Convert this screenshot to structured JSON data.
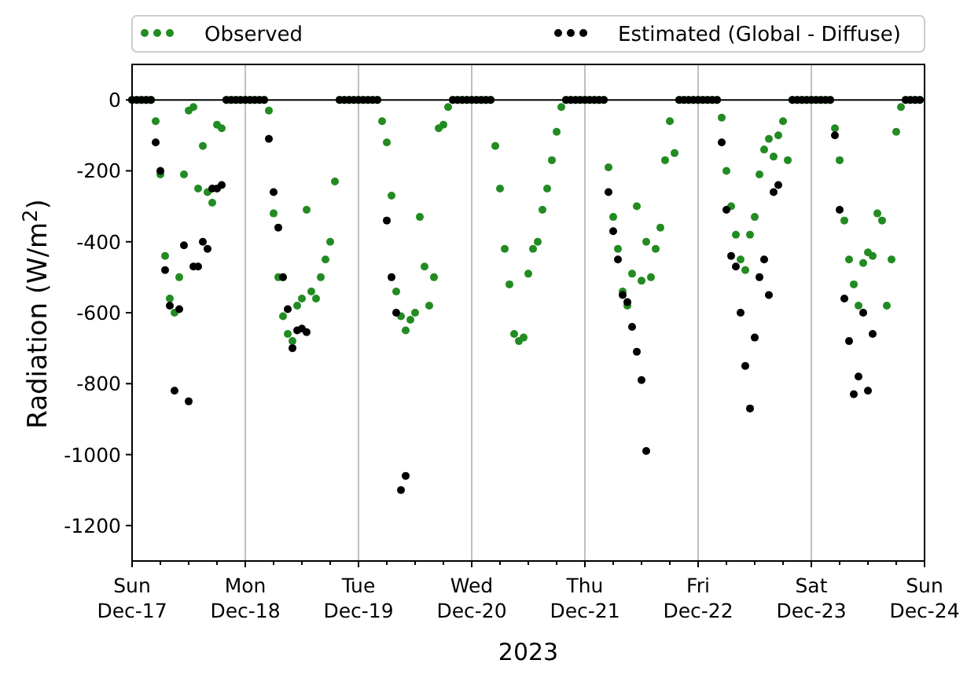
{
  "chart": {
    "chart_data": {
      "type": "scatter",
      "xlabel": "2023",
      "ylabel": "Radiation (W/m$^{2}$)",
      "legend": "top",
      "ylim": [
        -1300,
        100
      ],
      "yticks": [
        0,
        -200,
        -400,
        -600,
        -800,
        -1000,
        -1200
      ],
      "categories": [
        "Sun\nDec-17",
        null,
        null,
        null,
        null,
        null,
        null,
        null,
        null,
        null,
        null,
        null,
        null,
        null,
        null,
        null,
        null,
        null,
        null,
        null,
        null,
        null,
        null,
        null,
        "Mon\nDec-18",
        null,
        null,
        null,
        null,
        null,
        null,
        null,
        null,
        null,
        null,
        null,
        null,
        null,
        null,
        null,
        null,
        null,
        null,
        null,
        null,
        null,
        null,
        null,
        "Tue\nDec-19",
        null,
        null,
        null,
        null,
        null,
        null,
        null,
        null,
        null,
        null,
        null,
        null,
        null,
        null,
        null,
        null,
        null,
        null,
        null,
        null,
        null,
        null,
        null,
        "Wed\nDec-20",
        null,
        null,
        null,
        null,
        null,
        null,
        null,
        null,
        null,
        null,
        null,
        null,
        null,
        null,
        null,
        null,
        null,
        null,
        null,
        null,
        null,
        null,
        null,
        "Thu\nDec-21",
        null,
        null,
        null,
        null,
        null,
        null,
        null,
        null,
        null,
        null,
        null,
        null,
        null,
        null,
        null,
        null,
        null,
        null,
        null,
        null,
        null,
        null,
        null,
        "Fri\nDec-22",
        null,
        null,
        null,
        null,
        null,
        null,
        null,
        null,
        null,
        null,
        null,
        null,
        null,
        null,
        null,
        null,
        null,
        null,
        null,
        null,
        null,
        null,
        null,
        "Sat\nDec-23",
        null,
        null,
        null,
        null,
        null,
        null,
        null,
        null,
        null,
        null,
        null,
        null,
        null,
        null,
        null,
        null,
        null,
        null,
        null,
        null,
        null,
        null,
        null,
        "Sun\nDec-24"
      ],
      "series": [
        {
          "name": "Observed",
          "color": "#228b22",
          "values": [
            0,
            0,
            0,
            0,
            0,
            -60,
            -210,
            -440,
            -560,
            -600,
            -500,
            -210,
            -30,
            -20,
            -250,
            -130,
            -260,
            -290,
            -70,
            -80,
            0,
            0,
            0,
            0,
            0,
            0,
            0,
            0,
            0,
            -30,
            -320,
            -500,
            -610,
            -660,
            -680,
            -580,
            -560,
            -310,
            -540,
            -560,
            -500,
            -450,
            -400,
            -230,
            0,
            0,
            0,
            0,
            0,
            0,
            0,
            0,
            0,
            -60,
            -120,
            -270,
            -540,
            -610,
            -650,
            -620,
            -600,
            -330,
            -470,
            -580,
            -500,
            -80,
            -70,
            -20,
            0,
            0,
            0,
            0,
            0,
            0,
            0,
            0,
            0,
            -130,
            -250,
            -420,
            -520,
            -660,
            -680,
            -670,
            -490,
            -420,
            -400,
            -310,
            -250,
            -170,
            -90,
            -20,
            0,
            0,
            0,
            0,
            0,
            0,
            0,
            0,
            0,
            -190,
            -330,
            -420,
            -540,
            -580,
            -490,
            -300,
            -510,
            -400,
            -500,
            -420,
            -360,
            -170,
            -60,
            -150,
            0,
            0,
            0,
            0,
            0,
            0,
            0,
            0,
            0,
            -50,
            -200,
            -300,
            -380,
            -450,
            -480,
            -380,
            -330,
            -210,
            -140,
            -110,
            -160,
            -100,
            -60,
            -170,
            0,
            0,
            0,
            0,
            0,
            0,
            0,
            0,
            0,
            -80,
            -170,
            -340,
            -450,
            -520,
            -580,
            -460,
            -430,
            -440,
            -320,
            -340,
            -580,
            -450,
            -90,
            -20,
            0,
            0,
            0,
            0,
            null
          ]
        },
        {
          "name": "Estimated (Global - Diffuse)",
          "color": "#000000",
          "values": [
            0,
            0,
            0,
            0,
            0,
            -120,
            -200,
            -480,
            -580,
            -820,
            -590,
            -410,
            -850,
            -470,
            -470,
            -400,
            -420,
            -250,
            -250,
            -240,
            0,
            0,
            0,
            0,
            0,
            0,
            0,
            0,
            0,
            -110,
            -260,
            -360,
            -500,
            -590,
            -700,
            -650,
            -645,
            -655,
            null,
            null,
            null,
            null,
            null,
            null,
            0,
            0,
            0,
            0,
            0,
            0,
            0,
            0,
            0,
            null,
            -340,
            -500,
            -600,
            -1100,
            -1060,
            null,
            null,
            null,
            null,
            null,
            null,
            null,
            null,
            null,
            0,
            0,
            0,
            0,
            0,
            0,
            0,
            0,
            0,
            null,
            null,
            null,
            null,
            null,
            null,
            null,
            null,
            null,
            null,
            null,
            null,
            null,
            null,
            null,
            0,
            0,
            0,
            0,
            0,
            0,
            0,
            0,
            0,
            -260,
            -370,
            -450,
            -550,
            -570,
            -640,
            -710,
            -790,
            -990,
            null,
            null,
            null,
            null,
            null,
            null,
            0,
            0,
            0,
            0,
            0,
            0,
            0,
            0,
            0,
            -120,
            -310,
            -440,
            -470,
            -600,
            -750,
            -870,
            -670,
            -500,
            -450,
            -550,
            -260,
            -240,
            null,
            null,
            0,
            0,
            0,
            0,
            0,
            0,
            0,
            0,
            0,
            -100,
            -310,
            -560,
            -680,
            -830,
            -780,
            -600,
            -820,
            -660,
            null,
            null,
            null,
            null,
            null,
            null,
            0,
            0,
            0,
            0,
            null
          ]
        }
      ]
    }
  }
}
